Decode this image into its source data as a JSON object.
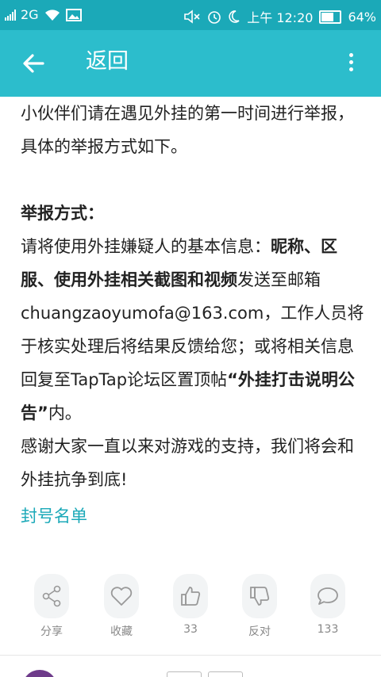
{
  "status_bar": {
    "network": "2G",
    "time": "上午 12:20",
    "battery": "64%",
    "icons": [
      "signal-icon",
      "wifi-icon",
      "image-icon",
      "mute-icon",
      "alarm-icon",
      "moon-icon",
      "battery-icon"
    ]
  },
  "app_bar": {
    "back_icon": "arrow-left-icon",
    "title": "返回",
    "more_icon": "more-vertical-icon"
  },
  "article": {
    "para1": "小伙伴们请在遇见外挂的第一时间进行举报，具体的举报方式如下。",
    "heading": "举报方式：",
    "p2_a": "请将使用外挂嫌疑人的基本信息：",
    "p2_b": "昵称、区服、使用外挂相关截图和视频",
    "p2_c": "发送至邮箱chuangzaoyumofa@163.com，工作人员将于核实处理后将结果反馈给您；或将相关信息回复至TapTap论坛区置顶帖",
    "p2_d": "“外挂打击说明公告”",
    "p2_e": "内。",
    "p3": "感谢大家一直以来对游戏的支持，我们将会和外挂抗争到底!",
    "link": "封号名单"
  },
  "actions": {
    "share": "分享",
    "favorite": "收藏",
    "like_count": "33",
    "oppose": "反对",
    "comment_count": "133"
  },
  "colors": {
    "status_bar": "#1ba9b8",
    "app_bar": "#2cbdcc",
    "accent": "#1ba9b8"
  }
}
